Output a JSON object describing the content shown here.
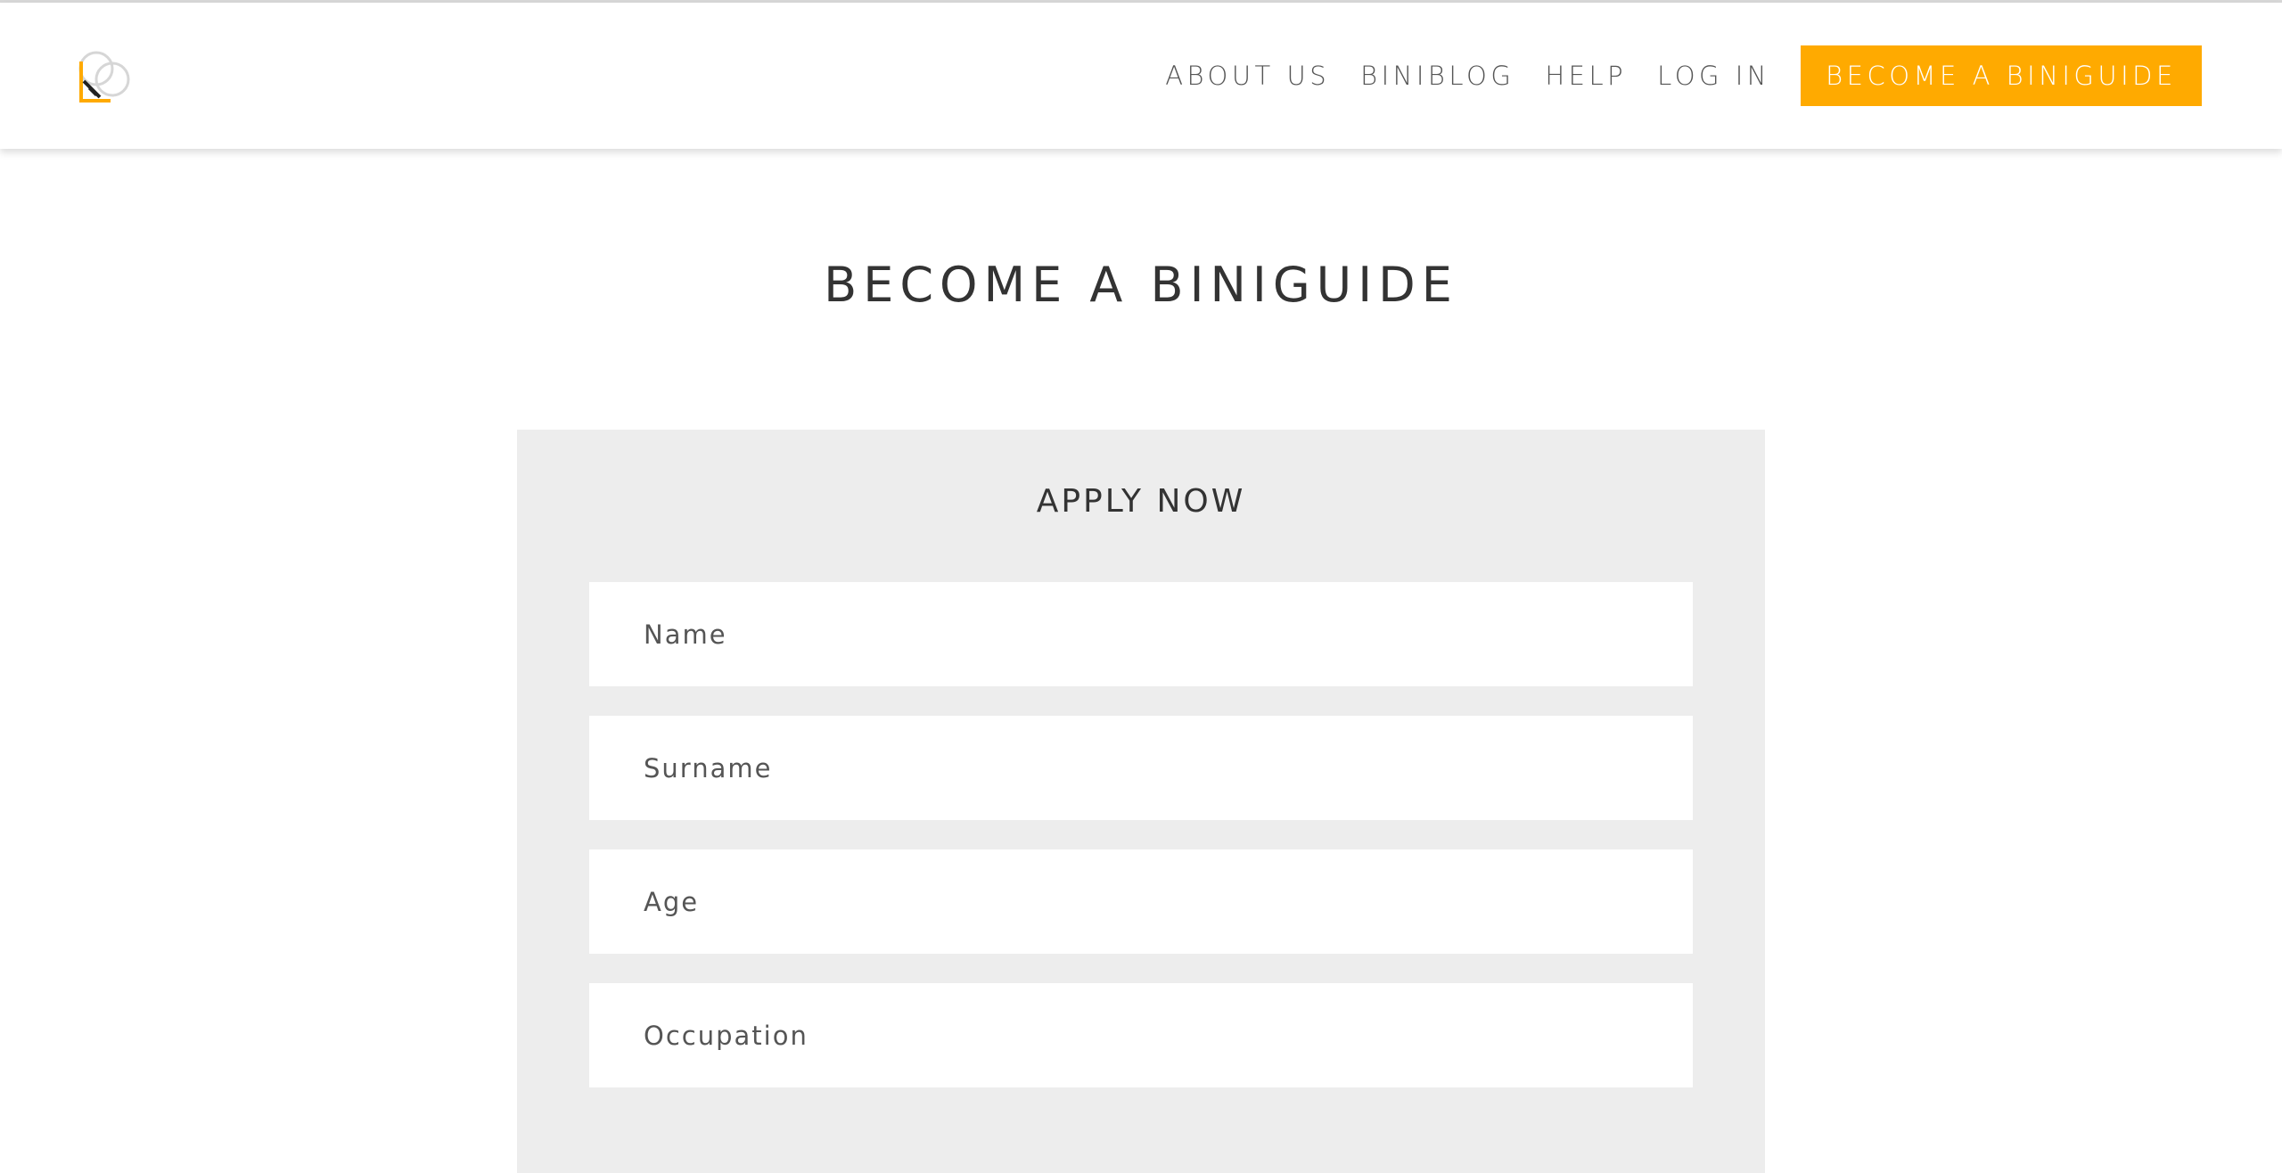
{
  "header": {
    "logo_icon": "biniguide-logo-icon",
    "nav": {
      "about": "ABOUT US",
      "blog": "BINIBLOG",
      "help": "HELP",
      "login": "LOG IN",
      "cta": "BECOME A BINIGUIDE"
    }
  },
  "page": {
    "title": "BECOME A BINIGUIDE"
  },
  "form": {
    "title": "APPLY NOW",
    "fields": [
      {
        "placeholder": "Name",
        "value": ""
      },
      {
        "placeholder": "Surname",
        "value": ""
      },
      {
        "placeholder": "Age",
        "value": ""
      },
      {
        "placeholder": "Occupation",
        "value": ""
      }
    ]
  },
  "colors": {
    "accent": "#ffaa00",
    "panel_bg": "#ededed",
    "text_dark": "#333333",
    "text_mid": "#555555"
  }
}
